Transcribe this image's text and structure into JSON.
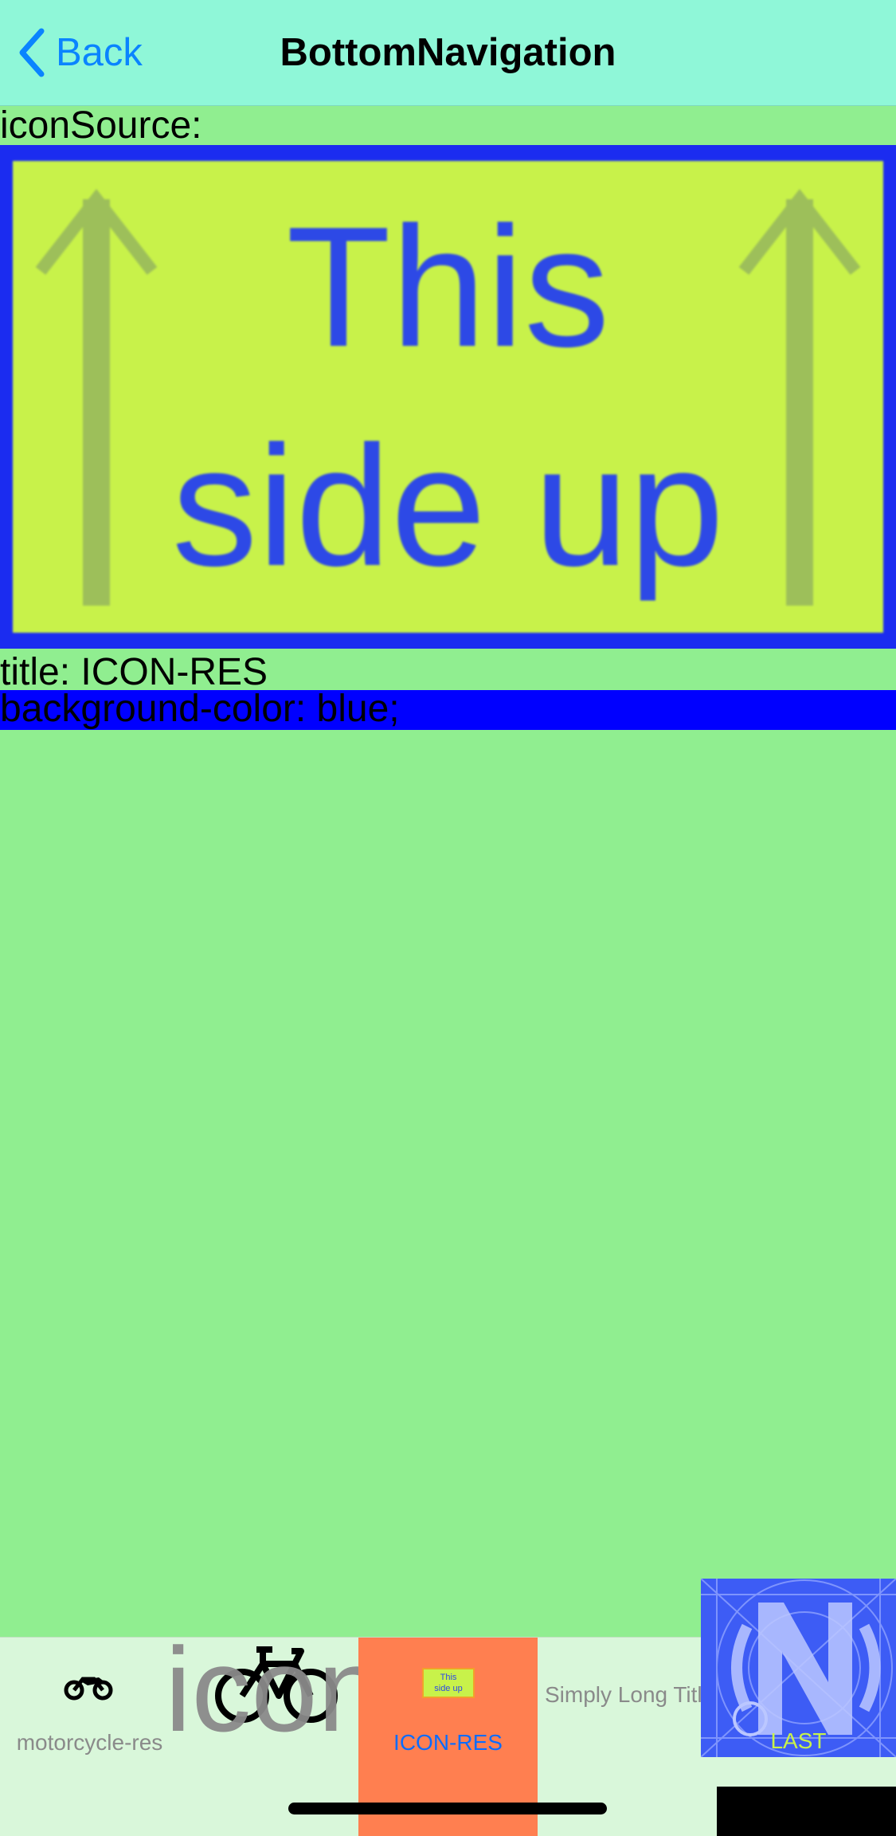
{
  "nav": {
    "back_label": "Back",
    "title": "BottomNavigation"
  },
  "content": {
    "icon_source_label": "iconSource:",
    "icon_image": {
      "line1": "This",
      "line2": "side up"
    },
    "title_line": "title: ICON-RES",
    "background_line": "background-color: blue;"
  },
  "tabs": [
    {
      "label": "motorcycle-res",
      "icon": "motorcycle-icon",
      "selected": false
    },
    {
      "label": "icon",
      "icon": "bicycle-icon",
      "selected": false
    },
    {
      "label": "ICON-RES",
      "icon": "this-side-up-icon",
      "selected": true,
      "icon_text": {
        "line1": "This",
        "line2": "side up"
      }
    },
    {
      "label": "Simply Long Title",
      "icon": "",
      "selected": false
    },
    {
      "label": "LAST",
      "icon": "n-logo-icon",
      "selected": false
    }
  ],
  "colors": {
    "page_bg": "#90EE90",
    "navbar_bg": "#8FF7D8",
    "accent": "#0A84FF",
    "selected_tab_bg": "#FF7F50",
    "last_tab_bg": "#3D5CF5",
    "blue_band": "#0000FF"
  }
}
